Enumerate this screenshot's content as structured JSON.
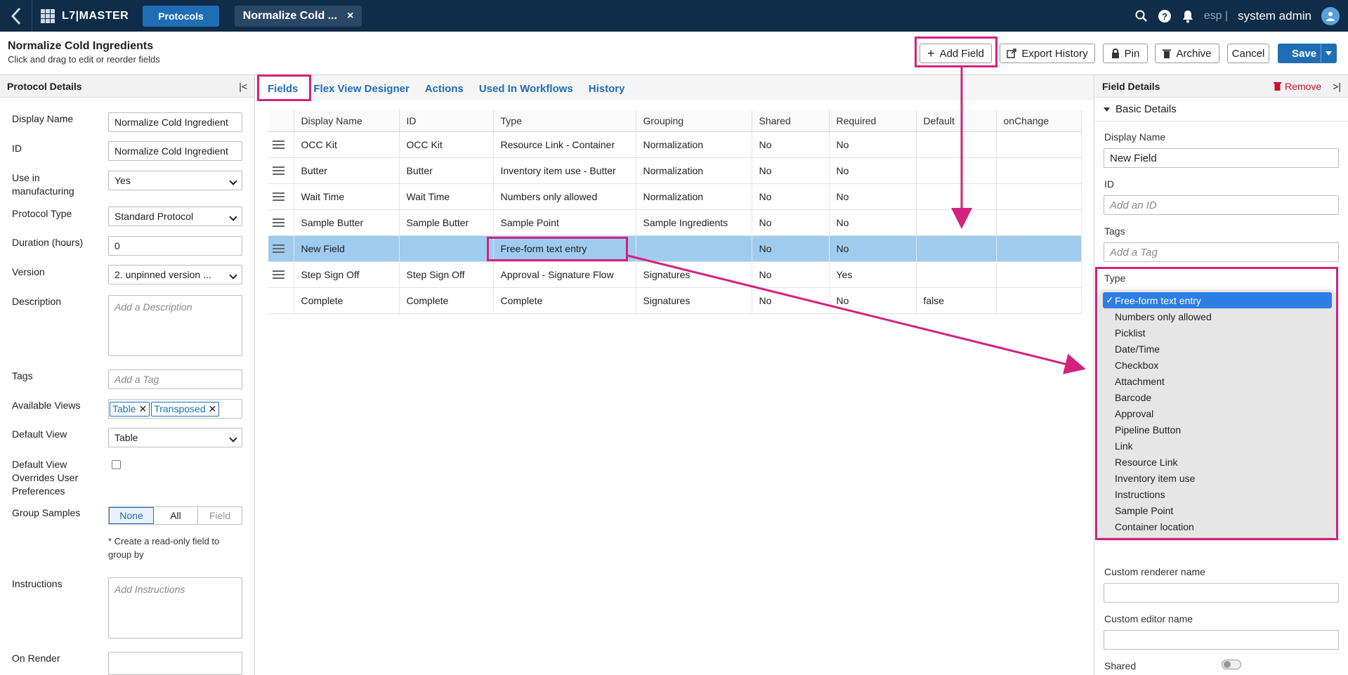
{
  "topbar": {
    "app_title": "L7|MASTER",
    "protocols_button": "Protocols",
    "open_tab_label": "Normalize Cold ...",
    "env": "esp |",
    "user": "system admin"
  },
  "header": {
    "title": "Normalize Cold Ingredients",
    "subtitle": "Click and drag to edit or reorder fields",
    "buttons": {
      "add_field": "Add Field",
      "export_history": "Export History",
      "pin": "Pin",
      "archive": "Archive",
      "cancel": "Cancel",
      "save": "Save"
    }
  },
  "left_panel": {
    "title": "Protocol Details",
    "display_name_label": "Display Name",
    "display_name_value": "Normalize Cold Ingredient",
    "id_label": "ID",
    "id_value": "Normalize Cold Ingredient",
    "use_mfg_label": "Use in manufacturing",
    "use_mfg_value": "Yes",
    "protocol_type_label": "Protocol Type",
    "protocol_type_value": "Standard Protocol",
    "duration_label": "Duration (hours)",
    "duration_value": "0",
    "version_label": "Version",
    "version_value": "2. unpinned version ...",
    "description_label": "Description",
    "description_placeholder": "Add a Description",
    "tags_label": "Tags",
    "tags_placeholder": "Add a Tag",
    "views_label": "Available Views",
    "views": [
      "Table",
      "Transposed"
    ],
    "default_view_label": "Default View",
    "default_view_value": "Table",
    "overrides_label": "Default View Overrides User Preferences",
    "group_samples_label": "Group Samples",
    "group_options": [
      "None",
      "All",
      "Field"
    ],
    "group_note": "* Create a read-only field to group by",
    "instructions_label": "Instructions",
    "instructions_placeholder": "Add Instructions",
    "on_render_label": "On Render"
  },
  "tabs": [
    "Fields",
    "Flex View Designer",
    "Actions",
    "Used In Workflows",
    "History"
  ],
  "table": {
    "columns": [
      "Display Name",
      "ID",
      "Type",
      "Grouping",
      "Shared",
      "Required",
      "Default",
      "onChange"
    ],
    "rows": [
      {
        "name": "OCC Kit",
        "id": "OCC Kit",
        "type": "Resource Link - Container",
        "grouping": "Normalization",
        "shared": "No",
        "required": "No",
        "default": ""
      },
      {
        "name": "Butter",
        "id": "Butter",
        "type": "Inventory item use - Butter",
        "grouping": "Normalization",
        "shared": "No",
        "required": "No",
        "default": ""
      },
      {
        "name": "Wait Time",
        "id": "Wait Time",
        "type": "Numbers only allowed",
        "grouping": "Normalization",
        "shared": "No",
        "required": "No",
        "default": ""
      },
      {
        "name": "Sample Butter",
        "id": "Sample Butter",
        "type": "Sample Point",
        "grouping": "Sample Ingredients",
        "shared": "No",
        "required": "No",
        "default": ""
      },
      {
        "name": "New Field",
        "id": "",
        "type": "Free-form text entry",
        "grouping": "",
        "shared": "No",
        "required": "No",
        "default": ""
      },
      {
        "name": "Step Sign Off",
        "id": "Step Sign Off",
        "type": "Approval - Signature Flow",
        "grouping": "Signatures",
        "shared": "No",
        "required": "Yes",
        "default": ""
      },
      {
        "name": "Complete",
        "id": "Complete",
        "type": "Complete",
        "grouping": "Signatures",
        "shared": "No",
        "required": "No",
        "default": "false"
      }
    ]
  },
  "right_panel": {
    "title": "Field Details",
    "remove": "Remove",
    "section": "Basic Details",
    "display_name_label": "Display Name",
    "display_name_value": "New Field",
    "id_label": "ID",
    "id_placeholder": "Add an ID",
    "tags_label": "Tags",
    "tags_placeholder": "Add a Tag",
    "type_label": "Type",
    "custom_renderer_label": "Custom renderer name",
    "custom_editor_label": "Custom editor name",
    "shared_label": "Shared"
  },
  "type_options": [
    "Free-form text entry",
    "Numbers only allowed",
    "Picklist",
    "Date/Time",
    "Checkbox",
    "Attachment",
    "Barcode",
    "Approval",
    "Pipeline Button",
    "Link",
    "Resource Link",
    "Inventory item use",
    "Instructions",
    "Sample Point",
    "Container location"
  ],
  "colors": {
    "nav": "#0f2c49",
    "accent": "#1f6eb5",
    "highlight": "#d4217f",
    "selected_row": "#9fcbee"
  }
}
